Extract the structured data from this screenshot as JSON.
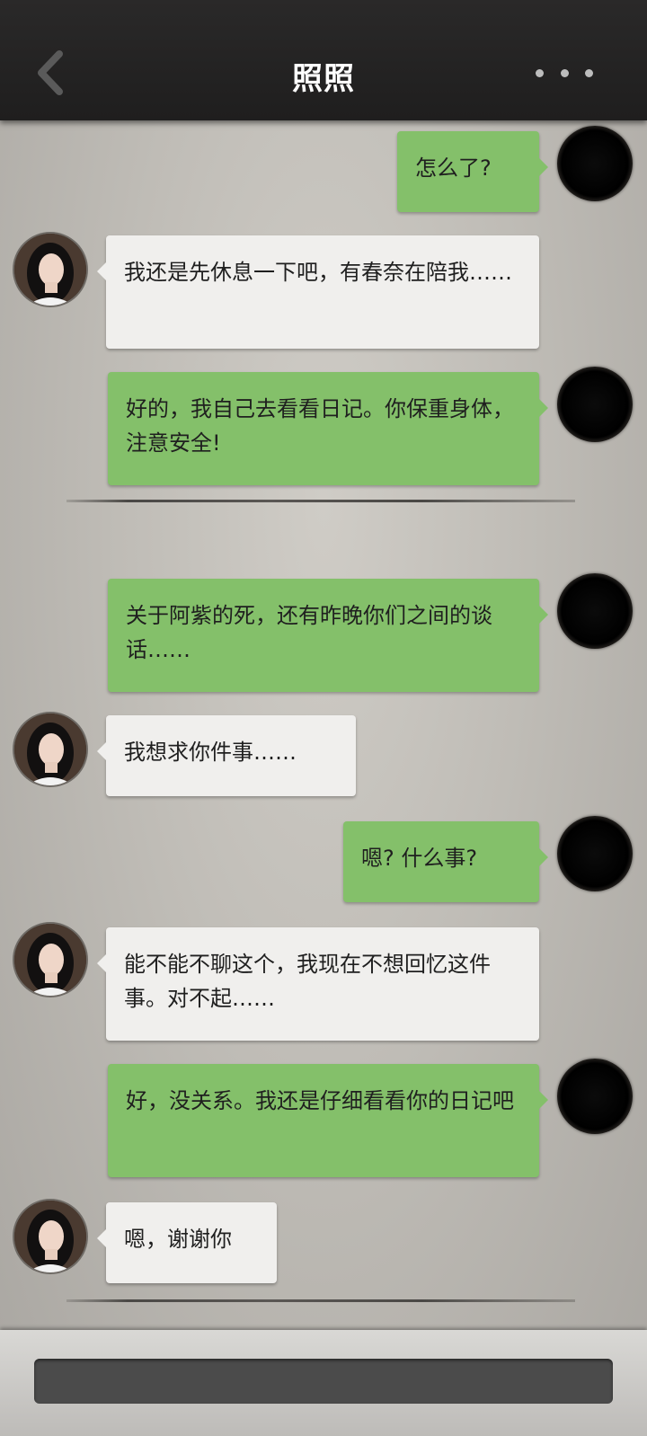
{
  "header": {
    "title": "照照",
    "back_icon": "chevron-left-icon",
    "more_icon": "more-dots-icon"
  },
  "colors": {
    "header_bg": "#222121",
    "my_bubble": "#84c06a",
    "other_bubble": "#f0efed",
    "input_bar": "#4b4b4b"
  },
  "messages": [
    {
      "sender": "me",
      "text": "怎么了?"
    },
    {
      "sender": "other",
      "text": "我还是先休息一下吧，有春奈在陪我……"
    },
    {
      "sender": "me",
      "text": "好的，我自己去看看日记。你保重身体，注意安全!"
    },
    {
      "sender": "me",
      "text": "关于阿紫的死，还有昨晚你们之间的谈话……"
    },
    {
      "sender": "other",
      "text": "我想求你件事……"
    },
    {
      "sender": "me",
      "text": "嗯? 什么事?"
    },
    {
      "sender": "other",
      "text": "能不能不聊这个，我现在不想回忆这件事。对不起……"
    },
    {
      "sender": "me",
      "text": "好，没关系。我还是仔细看看你的日记吧"
    },
    {
      "sender": "other",
      "text": "嗯，谢谢你"
    }
  ]
}
